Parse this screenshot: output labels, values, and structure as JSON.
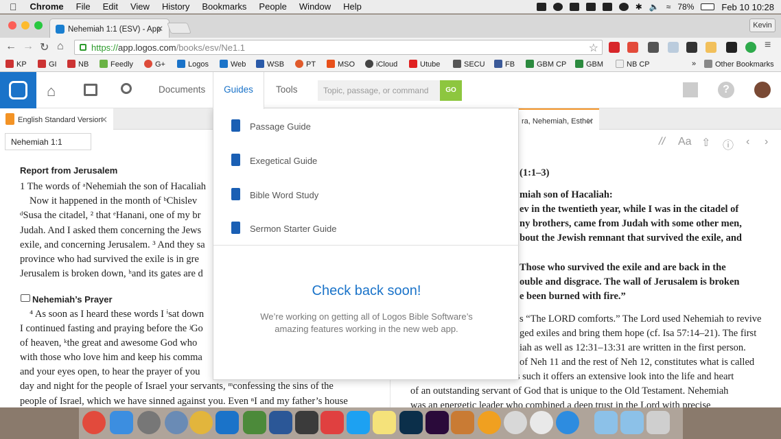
{
  "menubar": {
    "app": "Chrome",
    "items": [
      "File",
      "Edit",
      "View",
      "History",
      "Bookmarks",
      "People",
      "Window",
      "Help"
    ],
    "battery": "78%",
    "datetime": "Feb 10  10:28"
  },
  "browser": {
    "tab_title": "Nehemiah 1:1 (ESV) - App",
    "user": "Kevin",
    "url_scheme": "https://",
    "url_host": "app.logos.com",
    "url_path": "/books/esv/Ne1.1"
  },
  "bookmarks": [
    "KP",
    "GI",
    "NB",
    "Feedly",
    "G+",
    "Logos",
    "Web",
    "WSB",
    "PT",
    "MSO",
    "iCloud",
    "Utube",
    "SECU",
    "FB",
    "GBM CP",
    "GBM",
    "NB CP"
  ],
  "bookmarks_overflow": "»",
  "bookmarks_other": "Other Bookmarks",
  "app": {
    "nav": {
      "documents": "Documents",
      "guides": "Guides",
      "tools": "Tools"
    },
    "search_placeholder": "Topic, passage, or command",
    "go": "GO"
  },
  "panels": {
    "left_tab": "English Standard Version",
    "right_tab": "ra, Nehemiah, Esther",
    "reference": "Nehemiah 1:1",
    "tools": {
      "separator": "//",
      "font": "Aa"
    }
  },
  "guides_menu": {
    "items": [
      "Passage Guide",
      "Exegetical Guide",
      "Bible Word Study",
      "Sermon Starter Guide"
    ],
    "heading": "Check back soon!",
    "message": "We’re working on getting all of Logos Bible Software’s amazing features working in the new web app."
  },
  "left_text": {
    "heading1": "Report from Jerusalem",
    "heading2": "Nehemiah’s Prayer",
    "lines": [
      "1 The words of ᵃNehemiah the son of Hacaliah",
      "Now it happened in the month of ᵇChislev",
      "ᵈSusa the citadel, ² that ᵉHanani, one of my br",
      "Judah. And I asked them concerning the Jews",
      "exile, and concerning Jerusalem. ³ And they sa",
      "province who had survived the exile is in gre",
      "Jerusalem is broken down, ʰand its gates are d",
      "⁴ As soon as I heard these words I ⁱsat down",
      "I continued fasting and praying before the ʲGo",
      "of heaven, ᵏthe great and awesome God who",
      "with those who love him and keep his comma",
      "and your eyes open, to hear the prayer of you",
      "day and night for the people of Israel your servants, ᵐconfessing the sins of the",
      "people of Israel, which we have sinned against you. Even ⁿI and my father’s house"
    ]
  },
  "right_text": {
    "lines": [
      "(1:1–3)",
      "miah son of Hacaliah:",
      "ev in the twentieth year, while I was in the citadel of",
      "ny brothers, came from Judah with some other men,",
      "bout the Jewish remnant that survived the exile, and",
      "Those who survived the exile and are back in the",
      "ouble and disgrace. The wall of Jerusalem is broken",
      "e been burned with fire.”",
      "s “The LORD comforts.” The Lord used Nehemiah to revive",
      "ged exiles and bring them hope (cf. Isa 57:14–21). The first",
      "iah as well as 12:31–13:31 are written in the first person.",
      "of Neh 11 and the rest of Neh 12, constitutes what is called",
      "the Nehemiah Memoirs. As such it offers an extensive look into the life and heart",
      "of an outstanding servant of God that is unique to the Old Testament. Nehemiah",
      "was an energetic leader who combined a deep trust in the Lord with precise"
    ]
  }
}
